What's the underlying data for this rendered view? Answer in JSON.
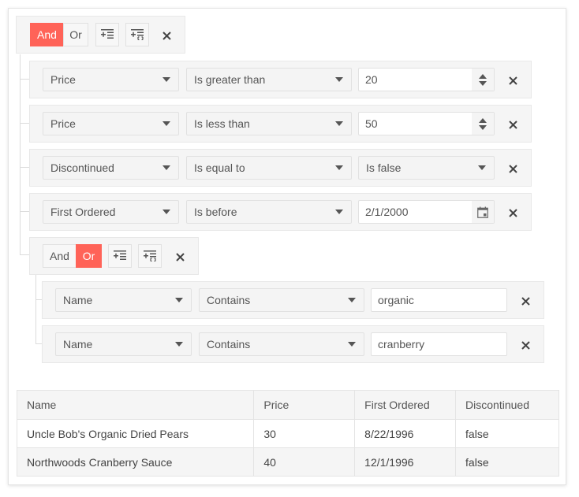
{
  "filter": {
    "root_group": {
      "logic_options": [
        "And",
        "Or"
      ],
      "active_logic": "And",
      "add_expression_title": "Add Expression",
      "add_group_title": "Add Group",
      "close_title": "Remove"
    },
    "rules": [
      {
        "field": "Price",
        "operator": "Is greater than",
        "value": "20",
        "editor": "numeric"
      },
      {
        "field": "Price",
        "operator": "Is less than",
        "value": "50",
        "editor": "numeric"
      },
      {
        "field": "Discontinued",
        "operator": "Is equal to",
        "value": "Is false",
        "editor": "dropdown"
      },
      {
        "field": "First Ordered",
        "operator": "Is before",
        "value": "2/1/2000",
        "editor": "date"
      }
    ],
    "sub_group": {
      "logic_options": [
        "And",
        "Or"
      ],
      "active_logic": "Or",
      "rules": [
        {
          "field": "Name",
          "operator": "Contains",
          "value": "organic",
          "editor": "text"
        },
        {
          "field": "Name",
          "operator": "Contains",
          "value": "cranberry",
          "editor": "text"
        }
      ]
    }
  },
  "grid": {
    "columns": [
      "Name",
      "Price",
      "First Ordered",
      "Discontinued"
    ],
    "rows": [
      [
        "Uncle Bob's Organic Dried Pears",
        "30",
        "8/22/1996",
        "false"
      ],
      [
        "Northwoods Cranberry Sauce",
        "40",
        "12/1/1996",
        "false"
      ]
    ]
  },
  "colors": {
    "accent": "#ff6358",
    "panel": "#f5f5f5",
    "border": "#e1e1e1",
    "text": "#555555"
  },
  "icons": {
    "add_expression": "add-expression-icon",
    "add_group": "add-group-icon",
    "close": "close-icon",
    "caret": "caret-down-icon",
    "spinner": "spinner-arrows-icon",
    "calendar": "calendar-icon"
  }
}
